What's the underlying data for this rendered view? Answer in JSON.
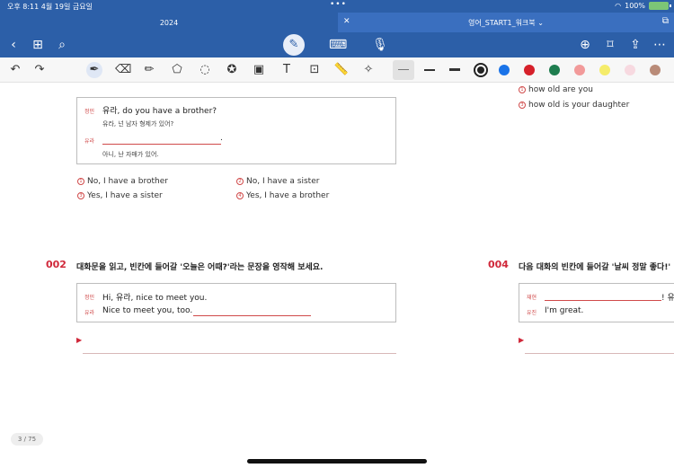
{
  "status": {
    "time": "오후 8:11",
    "date": "4월 19일 금요일",
    "battery": "100%"
  },
  "tabs": [
    {
      "label": "2024"
    },
    {
      "label": "영어_START1_워크북 ⌄"
    }
  ],
  "colors": {
    "brand": "#2c5fa8",
    "accent_red": "#d0283a",
    "palette": [
      "#222222",
      "#1a73e8",
      "#d6202a",
      "#1e7d4f",
      "#f29a9a",
      "#f5ec6a",
      "#f7d9e0",
      "#b98b78"
    ]
  },
  "page": {
    "indicator": "3 / 75",
    "q1": {
      "speaker1": "정민",
      "line1": "유라, do you have a brother?",
      "line1_kor": "유라, 넌 남자 형제가 있어?",
      "speaker2": "유라",
      "line2_end": ".",
      "line2_kor": "아니, 난 자매가 있어.",
      "options": [
        {
          "num": "1",
          "text": "No, I have a brother"
        },
        {
          "num": "3",
          "text": "Yes, I have a sister"
        },
        {
          "num": "2",
          "text": "No, I have a sister"
        },
        {
          "num": "4",
          "text": "Yes, I have a brother"
        }
      ]
    },
    "q_right_top": {
      "options": [
        {
          "num": "1",
          "text": "how old are you"
        },
        {
          "num": "3",
          "text": "how old is your daughter"
        }
      ]
    },
    "q2": {
      "number": "002",
      "prompt": "대화문을 읽고, 빈칸에 들어갈 '오늘은 어때?'라는 문장을 영작해 보세요.",
      "speaker1": "정민",
      "line1": "Hi, 유라, nice to meet you.",
      "speaker2": "유라",
      "line2": "Nice to meet you, too.",
      "arrow": "▶"
    },
    "q4": {
      "number": "004",
      "prompt": "다음 대화의 빈칸에 들어갈 '날씨 정말 좋다!'",
      "speaker1": "재현",
      "line1_end": "! 유",
      "speaker2": "유진",
      "line2": "I'm great.",
      "arrow": "▶"
    }
  }
}
